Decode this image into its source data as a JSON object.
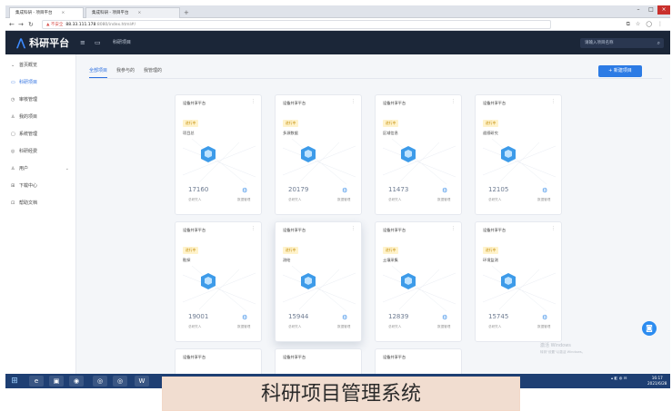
{
  "browser": {
    "tabs": [
      {
        "label": "集成科研 - 项目平台",
        "close": "×"
      },
      {
        "label": "集成科研 - 项目平台",
        "close": "×"
      }
    ],
    "new_tab": "+",
    "url_warning": "▲ 不安全",
    "url_host": "88.33.111.178",
    "url_path": ":8080/index.html#/",
    "window_controls": {
      "min": "–",
      "max": "□",
      "close": "×"
    }
  },
  "header": {
    "title": "科研平台",
    "breadcrumb": "科研项目",
    "search_placeholder": "请输入项目名称"
  },
  "sidebar": {
    "items": [
      {
        "label": "首页概览",
        "icon": "home-icon"
      },
      {
        "label": "科研项目",
        "icon": "folder-icon"
      },
      {
        "label": "审核管理",
        "icon": "audit-icon"
      },
      {
        "label": "我的项目",
        "icon": "user-icon"
      },
      {
        "label": "系统管理",
        "icon": "settings-icon"
      },
      {
        "label": "科研经费",
        "icon": "money-icon"
      },
      {
        "label": "用户",
        "icon": "people-icon"
      },
      {
        "label": "下载中心",
        "icon": "download-icon"
      },
      {
        "label": "帮助文档",
        "icon": "help-icon"
      }
    ]
  },
  "main": {
    "tabs": [
      "全部项目",
      "我参与的",
      "我管理的"
    ],
    "new_button": "+ 新建项目",
    "cards": [
      {
        "head": "设备共享平台",
        "badge": "进行中",
        "name": "项目总",
        "number": "17160",
        "label1": "总研究人",
        "label2": "数据管理"
      },
      {
        "head": "设备共享平台",
        "badge": "进行中",
        "name": "多源数据",
        "number": "20179",
        "label1": "总研究人",
        "label2": "数据管理"
      },
      {
        "head": "设备共享平台",
        "badge": "进行中",
        "name": "区域信息",
        "number": "11473",
        "label1": "总研究人",
        "label2": "数据管理"
      },
      {
        "head": "设备共享平台",
        "badge": "进行中",
        "name": "遥感研究",
        "number": "12105",
        "label1": "总研究人",
        "label2": "数据管理"
      },
      {
        "head": "设备共享平台",
        "badge": "进行中",
        "name": "勘探",
        "number": "19001",
        "label1": "总研究人",
        "label2": "数据管理"
      },
      {
        "head": "设备共享平台",
        "badge": "进行中",
        "name": "测绘",
        "number": "15944",
        "label1": "总研究人",
        "label2": "数据管理"
      },
      {
        "head": "设备共享平台",
        "badge": "进行中",
        "name": "土壤采集",
        "number": "12839",
        "label1": "总研究人",
        "label2": "数据管理"
      },
      {
        "head": "设备共享平台",
        "badge": "进行中",
        "name": "环境监测",
        "number": "15745",
        "label1": "总研究人",
        "label2": "数据管理"
      }
    ],
    "card_heads_bottom": [
      "设备共享平台",
      "设备共享平台",
      "设备共享平台"
    ]
  },
  "watermark": {
    "line1": "激活 Windows",
    "line2": "转到\"设置\"以激活 Windows。"
  },
  "taskbar": {
    "start": "⊞",
    "apps": [
      "e",
      "▣",
      "◉",
      "◎",
      "W"
    ],
    "time": "16:17",
    "date": "2021/6/28"
  },
  "caption": "科研项目管理系统",
  "colors": {
    "header_bg": "#1b2638",
    "accent": "#2c7be5",
    "badge_bg": "#fff3cc",
    "caption_bg": "#f1ddd0"
  }
}
